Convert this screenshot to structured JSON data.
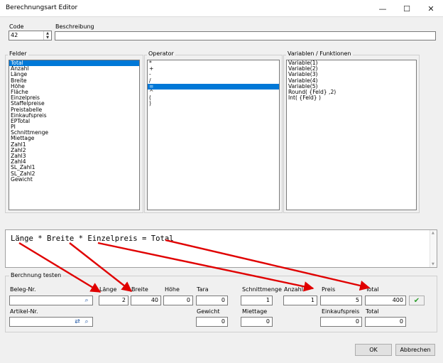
{
  "window": {
    "title": "Berechnungsart Editor",
    "minimize_glyph": "—",
    "maximize_glyph": "☐",
    "close_glyph": "✕"
  },
  "header": {
    "code_label": "Code",
    "code_value": "42",
    "description_label": "Beschreibung",
    "description_value": ""
  },
  "lists": {
    "felder_title": "Felder",
    "felder": [
      "Total",
      "Anzahl",
      "Länge",
      "Breite",
      "Höhe",
      "Fläche",
      "Einzelpreis",
      "Staffelpreise",
      "Preistabelle",
      "Einkaufspreis",
      "EPTotal",
      "PI",
      "Schnittmenge",
      "Miettage",
      "Zahl1",
      "Zahl2",
      "Zahl3",
      "Zahl4",
      "SL_Zahl1",
      "SL_Zahl2",
      "Gewicht"
    ],
    "felder_selected": 0,
    "operator_title": "Operator",
    "operators": [
      "*",
      "+",
      "-",
      "/",
      "=",
      "^",
      "(",
      ")"
    ],
    "operator_selected": 4,
    "variablen_title": "Variablen / Funktionen",
    "variablen": [
      "Variable(1)",
      "Variable(2)",
      "Variable(3)",
      "Variable(4)",
      "Variable(5)",
      "Round( {Feld} ,2)",
      "Int( {Feld} )"
    ]
  },
  "formula": {
    "text": "Länge * Breite * Einzelpreis = Total"
  },
  "test": {
    "group_title": "Berchnung testen",
    "beleg_label": "Beleg-Nr.",
    "beleg_value": "",
    "artikel_label": "Artikel-Nr.",
    "artikel_value": "",
    "laenge_label": "Länge",
    "laenge_value": "2",
    "breite_label": "Breite",
    "breite_value": "40",
    "hoehe_label": "Höhe",
    "hoehe_value": "0",
    "tara_label": "Tara",
    "tara_value": "0",
    "gewicht_label": "Gewicht",
    "gewicht_value": "0",
    "schnittmenge_label": "Schnittmenge",
    "schnittmenge_value": "1",
    "miettage_label": "Miettage",
    "miettage_value": "0",
    "anzahl_label": "Anzahl",
    "anzahl_value": "1",
    "preis_label": "Preis",
    "preis_value": "5",
    "einkaufspreis_label": "Einkaufspreis",
    "einkaufspreis_value": "0",
    "total_label": "Total",
    "total_value": "400",
    "total2_label": "Total",
    "total2_value": "0",
    "check_glyph": "✔",
    "search_glyph": "⌕",
    "refresh_glyph": "⇄"
  },
  "buttons": {
    "ok": "OK",
    "cancel": "Abbrechen"
  },
  "colors": {
    "selection": "#0078d7",
    "annotation_arrow": "#e00000",
    "check": "#2e9e2e"
  }
}
